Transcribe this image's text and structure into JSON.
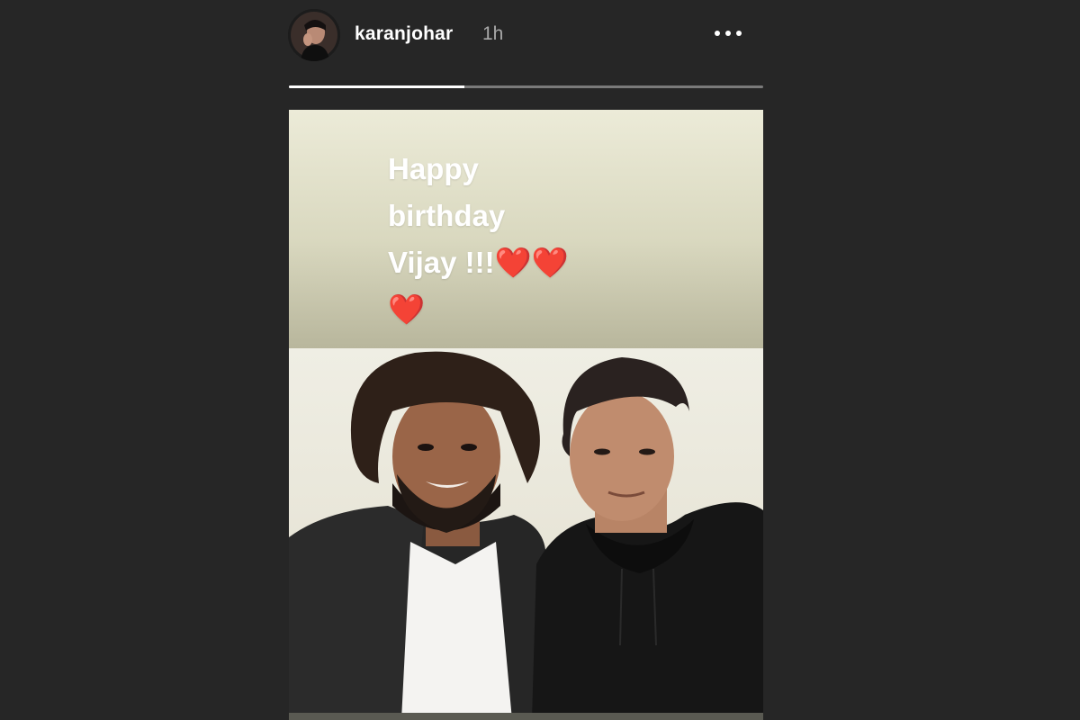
{
  "header": {
    "username": "karanjohar",
    "timestamp": "1h",
    "avatar_icon": "profile-avatar-icon",
    "more_icon": "more-options-icon"
  },
  "progress": {
    "segments": 1,
    "fraction_complete": 0.37
  },
  "story": {
    "caption": "Happy\nbirthday\nVijay !!!❤️❤️\n❤️",
    "photo": "photo of two men posing together, one with long hair and beard in leather jacket, one in black hoodie"
  },
  "colors": {
    "background": "#262626",
    "text": "#ffffff",
    "timestamp": "#a8a8a8",
    "progress_track": "#7a7a7a",
    "progress_fill": "#ffffff",
    "heart": "#e0162b"
  }
}
